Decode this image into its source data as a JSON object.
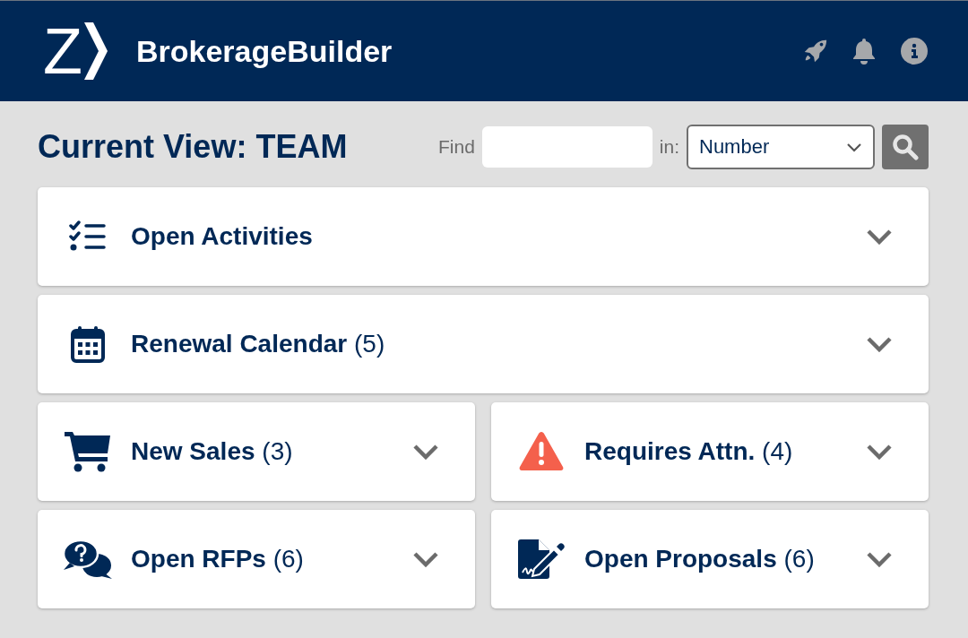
{
  "header": {
    "logo_letter": "Z",
    "app_name": "BrokerageBuilder"
  },
  "view_title": "Current View: TEAM",
  "search": {
    "find_label": "Find",
    "in_label": "in:",
    "field": "Number"
  },
  "panel_rows": [
    [
      {
        "title": "Open Activities",
        "expanded": false
      }
    ],
    [
      {
        "title": "Renewal Calendar",
        "count": "(5)",
        "expanded": false
      }
    ],
    [
      {
        "title": "New Sales",
        "count": "(3)",
        "expanded": false
      },
      {
        "title": "Requires Attn.",
        "count": "(4)",
        "expanded": false
      }
    ],
    [
      {
        "title": "Open RFPs",
        "count": "(6)",
        "expanded": false
      },
      {
        "title": "Open Proposals",
        "count": "(6)",
        "expanded": false
      }
    ]
  ]
}
